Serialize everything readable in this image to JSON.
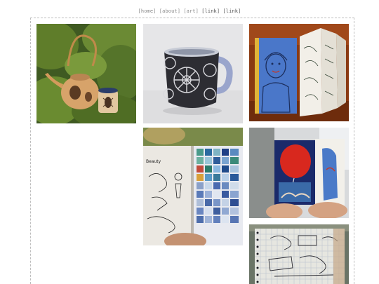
{
  "nav": {
    "home": "[home]",
    "about": "[about]",
    "art": "[art]",
    "link1": "[link]",
    "link2": "[link]"
  },
  "gallery": {
    "images": [
      {
        "name": "teapot-and-cup-photo",
        "subject": "ceramic teapot and cup with beetle drawings on mossy background"
      },
      {
        "name": "black-white-mug-photo",
        "subject": "black and white sgraffito floral mug with blue handle"
      },
      {
        "name": "sketchbook-portrait-photo",
        "subject": "accordion sketchbook with blue portrait drawing"
      },
      {
        "name": "mosaic-sketchbook-photo",
        "subject": "sketchbook spread with ink drawings and blue paper mosaic collage"
      },
      {
        "name": "red-balloon-sketchbook-photo",
        "subject": "small sketchbook with red and blue painting held in hand"
      },
      {
        "name": "grid-notebook-photo",
        "subject": "grid notebook with ink sketches"
      }
    ]
  },
  "page_colors": {
    "nav_text": "#8a8a8a",
    "frame_border": "#bdbdbd",
    "background": "#ffffff"
  }
}
